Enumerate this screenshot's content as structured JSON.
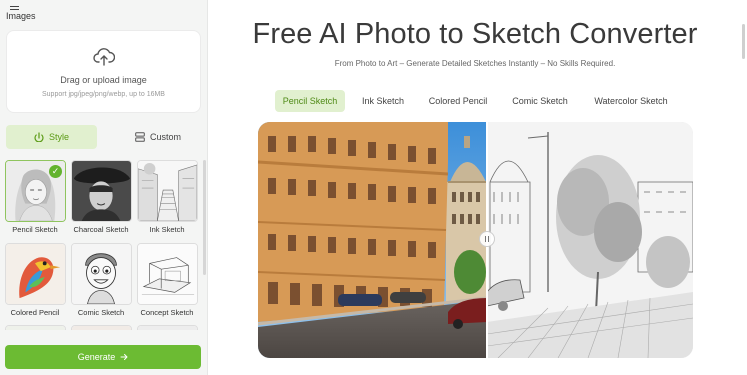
{
  "sidebar": {
    "images_label": "Images",
    "upload": {
      "title": "Drag or upload image",
      "subtitle": "Support jpg/jpeg/png/webp, up to 16MB",
      "icon": "cloud-upload-icon"
    },
    "tabs": [
      {
        "label": "Style",
        "active": true,
        "icon": "style-icon"
      },
      {
        "label": "Custom",
        "active": false,
        "icon": "custom-icon"
      }
    ],
    "styles": [
      {
        "label": "Pencil Sketch",
        "selected": true
      },
      {
        "label": "Charcoal Sketch",
        "selected": false
      },
      {
        "label": "Ink Sketch",
        "selected": false
      },
      {
        "label": "Colored Pencil",
        "selected": false
      },
      {
        "label": "Comic Sketch",
        "selected": false
      },
      {
        "label": "Concept Sketch",
        "selected": false
      }
    ],
    "generate_label": "Generate",
    "generate_icon": "arrow-right-icon"
  },
  "main": {
    "title": "Free AI Photo to Sketch Converter",
    "subtitle": "From Photo to Art – Generate Detailed Sketches Instantly – No Skills Required.",
    "style_tabs": [
      {
        "label": "Pencil Sketch",
        "active": true
      },
      {
        "label": "Ink Sketch",
        "active": false
      },
      {
        "label": "Colored Pencil",
        "active": false
      },
      {
        "label": "Comic Sketch",
        "active": false
      },
      {
        "label": "Watercolor Sketch",
        "active": false
      }
    ]
  },
  "colors": {
    "accent": "#6cbb33",
    "accent_light": "#e1f0cf",
    "accent_text": "#5a9a14"
  }
}
